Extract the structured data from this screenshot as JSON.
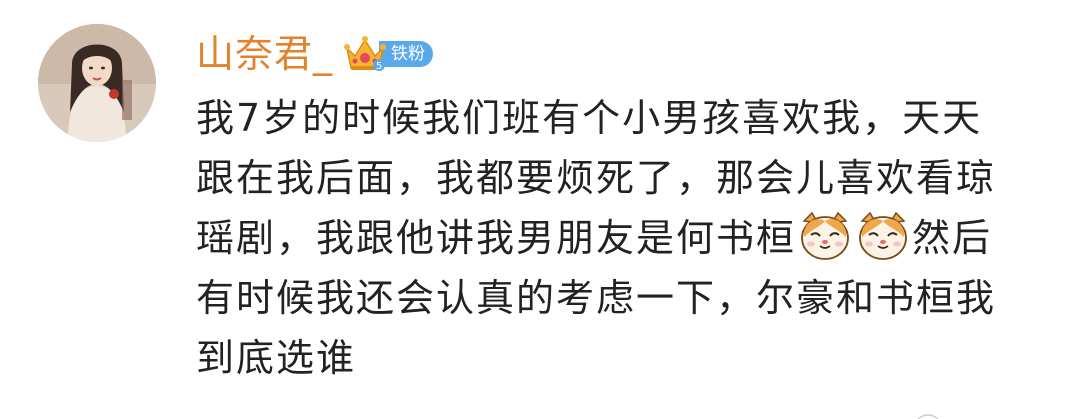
{
  "comment": {
    "username": "山奈君_",
    "badge": {
      "label": "铁粉",
      "crown_icon": "crown-icon",
      "color": "#5aa8ec"
    },
    "username_color": "#e2822c",
    "text_lines": [
      "我7岁的时候我们班有个小男孩喜欢我，天天",
      "跟在我后面，我都要烦死了，那会儿喜欢看琼",
      "瑶剧，我跟他讲我男朋友是何书桓",
      "然后",
      "有时候我还会认真的考虑一下，尔豪和书桓我",
      "到底选谁"
    ],
    "emoji_name": "cat-face-emoji-icon"
  }
}
